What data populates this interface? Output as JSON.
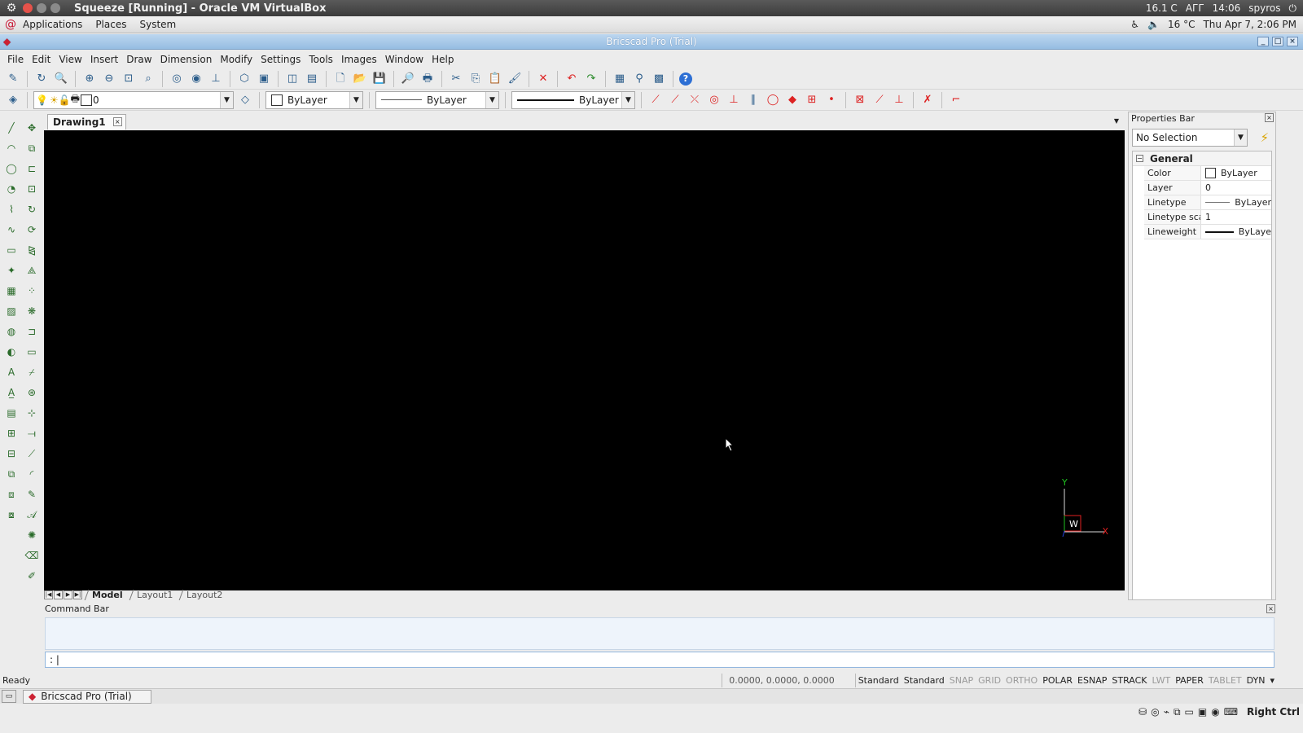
{
  "host": {
    "window_title": "Squeeze [Running] - Oracle VM VirtualBox",
    "tray": {
      "weather": "16.1 C",
      "keyboard": "AГГ",
      "time": "14:06",
      "user": "spyros"
    }
  },
  "gnome_panel": {
    "menus": [
      "Applications",
      "Places",
      "System"
    ],
    "weather": "16 °C",
    "clock": "Thu Apr 7, 2:06 PM"
  },
  "app": {
    "title": "Bricscad Pro (Trial)",
    "menu": [
      "File",
      "Edit",
      "View",
      "Insert",
      "Draw",
      "Dimension",
      "Modify",
      "Settings",
      "Tools",
      "Images",
      "Window",
      "Help"
    ],
    "layer_value": "0",
    "color_value": "ByLayer",
    "linetype_value": "ByLayer",
    "lineweight_value": "ByLayer"
  },
  "document": {
    "tab": "Drawing1",
    "layout_tabs": [
      "Model",
      "Layout1",
      "Layout2"
    ],
    "ucs": {
      "y": "Y",
      "x": "X",
      "w": "W"
    }
  },
  "properties": {
    "header": "Properties Bar",
    "selection": "No Selection",
    "category": "General",
    "rows": [
      {
        "key": "Color",
        "value": "ByLayer"
      },
      {
        "key": "Layer",
        "value": "0"
      },
      {
        "key": "Linetype",
        "value": "ByLayer"
      },
      {
        "key": "Linetype sca",
        "value": "1"
      },
      {
        "key": "Lineweight",
        "value": "ByLaye"
      }
    ]
  },
  "command_bar": {
    "header": "Command Bar",
    "prompt": ": |"
  },
  "status": {
    "ready": "Ready",
    "coords": "0.0000, 0.0000, 0.0000",
    "styles": [
      "Standard",
      "Standard"
    ],
    "toggles": [
      {
        "label": "SNAP",
        "on": false
      },
      {
        "label": "GRID",
        "on": false
      },
      {
        "label": "ORTHO",
        "on": false
      },
      {
        "label": "POLAR",
        "on": true
      },
      {
        "label": "ESNAP",
        "on": true
      },
      {
        "label": "STRACK",
        "on": true
      },
      {
        "label": "LWT",
        "on": false
      },
      {
        "label": "PAPER",
        "on": true
      },
      {
        "label": "TABLET",
        "on": false
      },
      {
        "label": "DYN",
        "on": true
      }
    ]
  },
  "taskbar": {
    "task": "Bricscad Pro (Trial)"
  },
  "host_bottom": {
    "key": "Right Ctrl"
  },
  "colors": {
    "canvas": "#000000",
    "app_title_bg": "#96bde2",
    "ucs_x": "#e02020",
    "ucs_y": "#20c020"
  }
}
